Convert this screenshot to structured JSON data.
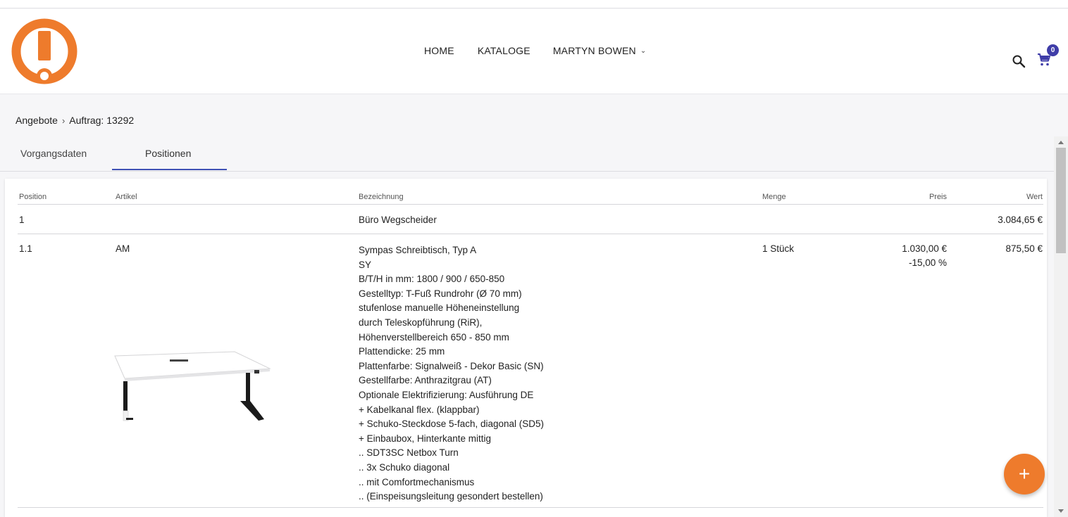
{
  "nav": {
    "home": "HOME",
    "kataloge": "KATALOGE",
    "user": "MARTYN BOWEN"
  },
  "cart": {
    "count": "0"
  },
  "breadcrumb": {
    "parent": "Angebote",
    "current": "Auftrag: 13292"
  },
  "tabs": [
    {
      "label": "Vorgangsdaten"
    },
    {
      "label": "Positionen"
    }
  ],
  "table": {
    "headers": {
      "position": "Position",
      "artikel": "Artikel",
      "bezeichnung": "Bezeichnung",
      "menge": "Menge",
      "preis": "Preis",
      "wert": "Wert"
    },
    "rows": [
      {
        "position": "1",
        "artikel": "",
        "bezeichnung": "Büro Wegscheider",
        "menge": "",
        "preis": "",
        "rabatt": "",
        "wert": "3.084,65 €"
      },
      {
        "position": "1.1",
        "artikel": "AM",
        "bezeichnung_lines": [
          "Sympas Schreibtisch, Typ A",
          "SY",
          "B/T/H in mm: 1800 / 900 / 650-850",
          "Gestelltyp: T-Fuß Rundrohr (Ø 70 mm)",
          "stufenlose manuelle Höheneinstellung",
          "durch Teleskopführung (RiR),",
          "Höhenverstellbereich 650 - 850 mm",
          "Plattendicke: 25 mm",
          "Plattenfarbe: Signalweiß - Dekor Basic (SN)",
          "Gestellfarbe: Anthrazitgrau (AT)",
          "Optionale Elektrifizierung: Ausführung DE",
          "+ Kabelkanal flex. (klappbar)",
          "+ Schuko-Steckdose 5-fach, diagonal (SD5)",
          "+ Einbaubox, Hinterkante mittig",
          ".. SDT3SC Netbox Turn",
          ".. 3x Schuko diagonal",
          ".. mit Comfortmechanismus",
          ".. (Einspeisungsleitung gesondert bestellen)"
        ],
        "menge": "1 Stück",
        "preis": "1.030,00 €",
        "rabatt": "-15,00 %",
        "wert": "875,50 €"
      }
    ]
  },
  "fab": {
    "label": "+"
  },
  "colors": {
    "accent": "#ee7b2c",
    "primary": "#3f51b5",
    "badge": "#3f3da8"
  }
}
